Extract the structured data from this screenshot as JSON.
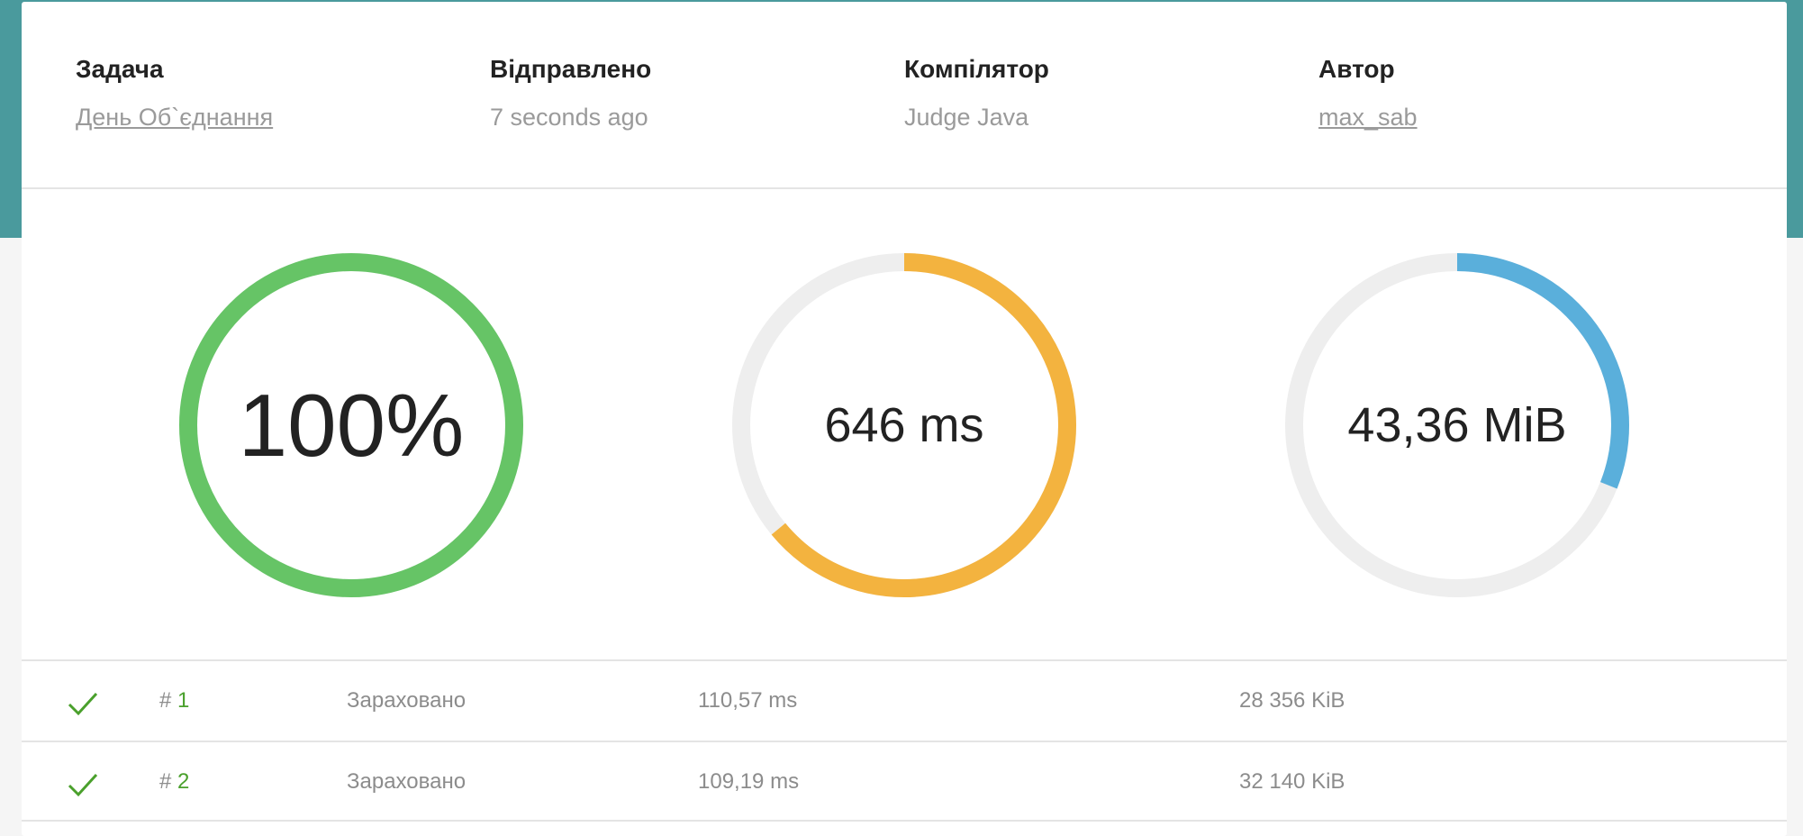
{
  "meta": {
    "task_label": "Задача",
    "task_value": "День Об`єднання",
    "sent_label": "Відправлено",
    "sent_value": "7 seconds ago",
    "compiler_label": "Компілятор",
    "compiler_value": "Judge Java",
    "author_label": "Автор",
    "author_value": "max_sab"
  },
  "gauges": {
    "score": {
      "text": "100%",
      "fraction": 1.0,
      "color": "#66c466"
    },
    "time": {
      "text": "646 ms",
      "fraction": 0.64,
      "color": "#f3b33f"
    },
    "memory": {
      "text": "43,36 MiB",
      "fraction": 0.31,
      "color": "#5aafdb"
    },
    "track_color": "#eeeeee"
  },
  "tests": [
    {
      "hash": "#",
      "number": "1",
      "status": "Зараховано",
      "time": "110,57 ms",
      "memory": "28 356 KiB"
    },
    {
      "hash": "#",
      "number": "2",
      "status": "Зараховано",
      "time": "109,19 ms",
      "memory": "32 140 KiB"
    }
  ],
  "icons": {
    "passed": "check-icon"
  }
}
